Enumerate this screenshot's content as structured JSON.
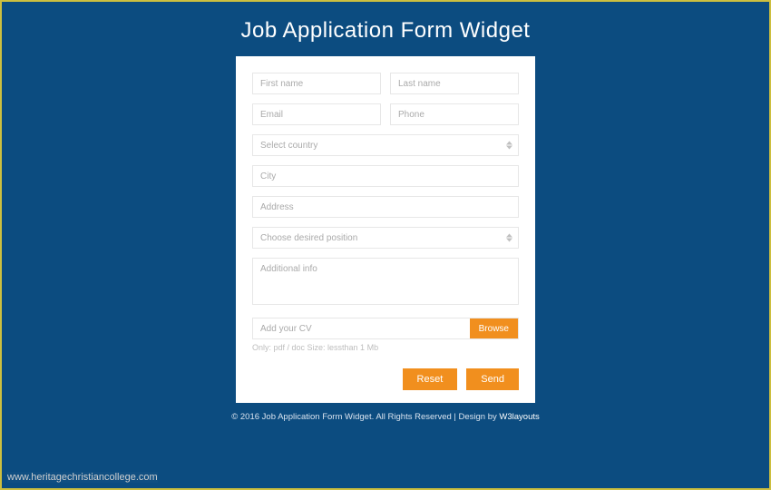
{
  "title": "Job Application Form Widget",
  "fields": {
    "firstName": "First name",
    "lastName": "Last name",
    "email": "Email",
    "phone": "Phone",
    "country": "Select country",
    "city": "City",
    "address": "Address",
    "position": "Choose desired position",
    "additionalInfo": "Additional info",
    "cvPlaceholder": "Add your CV",
    "cvHint": "Only: pdf / doc Size: lessthan 1 Mb"
  },
  "buttons": {
    "browse": "Browse",
    "reset": "Reset",
    "send": "Send"
  },
  "footer": {
    "prefix": "© 2016 Job Application Form Widget. All Rights Reserved | Design by ",
    "link": "W3layouts"
  },
  "watermark": "www.heritagechristiancollege.com"
}
